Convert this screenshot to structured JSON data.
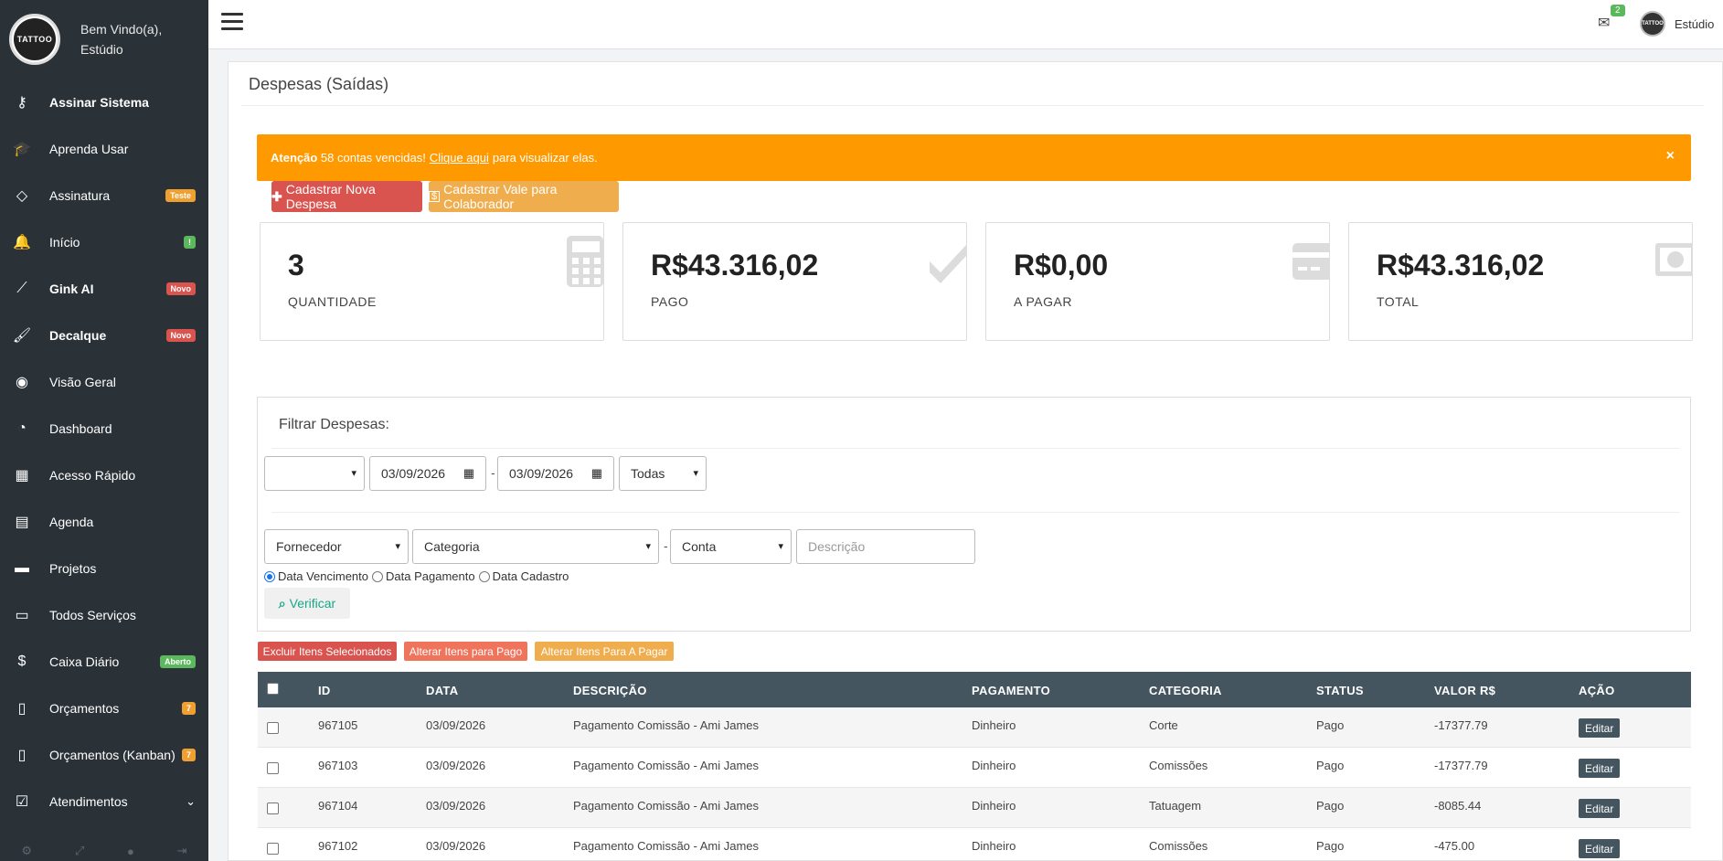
{
  "sidebar": {
    "logo_text": "TATTOO",
    "welcome_line1": "Bem Vindo(a),",
    "welcome_line2": "Estúdio",
    "items": [
      {
        "label": "Assinar Sistema",
        "icon": "key-icon",
        "bold": true
      },
      {
        "label": "Aprenda Usar",
        "icon": "graduation-cap-icon"
      },
      {
        "label": "Assinatura",
        "icon": "diamond-icon",
        "badge": "Teste",
        "badge_color": "#f0a030"
      },
      {
        "label": "Início",
        "icon": "bell-icon",
        "badge": "!",
        "badge_color": "#5cb85c"
      },
      {
        "label": "Gink AI",
        "icon": "magic-wand-icon",
        "badge": "Novo",
        "badge_color": "#d9534f",
        "bold": true
      },
      {
        "label": "Decalque",
        "icon": "paintbrush-icon",
        "badge": "Novo",
        "badge_color": "#d9534f",
        "bold": true
      },
      {
        "label": "Visão Geral",
        "icon": "eye-icon"
      },
      {
        "label": "Dashboard",
        "icon": "dashboard-icon"
      },
      {
        "label": "Acesso Rápido",
        "icon": "grid-icon"
      },
      {
        "label": "Agenda",
        "icon": "calendar-icon"
      },
      {
        "label": "Projetos",
        "icon": "folder-icon"
      },
      {
        "label": "Todos Serviços",
        "icon": "folder-open-icon"
      },
      {
        "label": "Caixa Diário",
        "icon": "money-icon",
        "badge": "Aberto",
        "badge_color": "#5cb85c"
      },
      {
        "label": "Orçamentos",
        "icon": "document-icon",
        "badge": "7",
        "badge_color": "#f0a030"
      },
      {
        "label": "Orçamentos (Kanban)",
        "icon": "document-icon",
        "badge": "7",
        "badge_color": "#f0a030"
      },
      {
        "label": "Atendimentos",
        "icon": "check-square-icon",
        "chevron": true
      }
    ]
  },
  "topbar": {
    "mail_count": "2",
    "user_name": "Estúdio"
  },
  "page": {
    "title": "Despesas (Saídas)"
  },
  "alert": {
    "strong": "Atenção",
    "count_text": "58 contas vencidas!",
    "link": "Clique aqui",
    "rest": "para visualizar elas.",
    "close": "×"
  },
  "actions": {
    "new_expense": "Cadastrar Nova Despesa",
    "new_voucher": "Cadastrar Vale para Colaborador"
  },
  "stats": [
    {
      "value": "3",
      "label": "QUANTIDADE",
      "icon": "calculator-icon"
    },
    {
      "value": "R$43.316,02",
      "label": "PAGO",
      "icon": "check-icon"
    },
    {
      "value": "R$0,00",
      "label": "A PAGAR",
      "icon": "credit-card-icon"
    },
    {
      "value": "R$43.316,02",
      "label": "TOTAL",
      "icon": "money-bill-icon"
    }
  ],
  "filter": {
    "title": "Filtrar Despesas:",
    "period_select": "",
    "date_from": "03/09/2026",
    "date_to": "03/09/2026",
    "status_select": "Todas",
    "supplier": "Fornecedor",
    "category": "Categoria",
    "account": "Conta",
    "description_placeholder": "Descrição",
    "radio_options": [
      "Data Vencimento",
      "Data Pagamento",
      "Data Cadastro"
    ],
    "radio_selected": "Data Vencimento",
    "verify": "Verificar"
  },
  "bulk": {
    "delete": "Excluir Itens Selecionados",
    "mark_paid": "Alterar Itens para Pago",
    "mark_unpaid": "Alterar Itens Para A Pagar"
  },
  "table": {
    "columns": [
      "ID",
      "DATA",
      "DESCRIÇÃO",
      "PAGAMENTO",
      "CATEGORIA",
      "STATUS",
      "VALOR R$",
      "AÇÃO"
    ],
    "action_label": "Editar",
    "rows": [
      {
        "id": "967105",
        "date": "03/09/2026",
        "description": "Pagamento Comissão - Ami James",
        "payment": "Dinheiro",
        "category": "Corte",
        "status": "Pago",
        "value": "-17377.79"
      },
      {
        "id": "967103",
        "date": "03/09/2026",
        "description": "Pagamento Comissão - Ami James",
        "payment": "Dinheiro",
        "category": "Comissões",
        "status": "Pago",
        "value": "-17377.79"
      },
      {
        "id": "967104",
        "date": "03/09/2026",
        "description": "Pagamento Comissão - Ami James",
        "payment": "Dinheiro",
        "category": "Tatuagem",
        "status": "Pago",
        "value": "-8085.44"
      },
      {
        "id": "967102",
        "date": "03/09/2026",
        "description": "Pagamento Comissão - Ami James",
        "payment": "Dinheiro",
        "category": "Comissões",
        "status": "Pago",
        "value": "-475.00"
      }
    ]
  },
  "colors": {
    "sidebar_bg": "#2a3238",
    "alert_bg": "#ff9900",
    "table_header": "#445560",
    "danger": "#d9534f",
    "warning": "#f0ad4e",
    "verify_text": "#18a689"
  }
}
